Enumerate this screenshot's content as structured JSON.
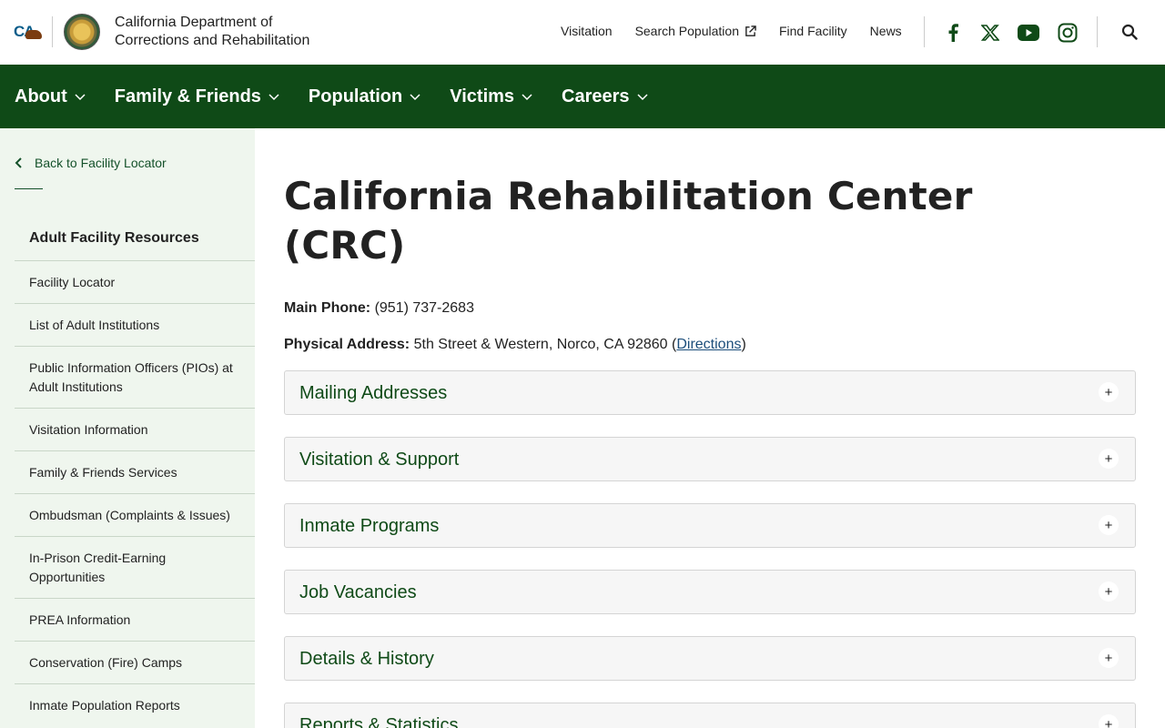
{
  "header": {
    "logo_text": "CA",
    "org_name_line1": "California Department of",
    "org_name_line2": "Corrections and Rehabilitation",
    "top_links": [
      {
        "label": "Visitation",
        "external": false
      },
      {
        "label": "Search Population",
        "external": true
      },
      {
        "label": "Find Facility",
        "external": false
      },
      {
        "label": "News",
        "external": false
      }
    ],
    "social_icons": [
      "facebook-icon",
      "x-twitter-icon",
      "youtube-icon",
      "instagram-icon"
    ],
    "search_icon": "search-icon"
  },
  "nav": {
    "items": [
      {
        "label": "About"
      },
      {
        "label": "Family & Friends"
      },
      {
        "label": "Population"
      },
      {
        "label": "Victims"
      },
      {
        "label": "Careers"
      }
    ]
  },
  "sidebar": {
    "back_label": "Back to Facility Locator",
    "heading": "Adult Facility Resources",
    "items": [
      {
        "label": "Facility Locator"
      },
      {
        "label": "List of Adult Institutions"
      },
      {
        "label": "Public Information Officers (PIOs) at Adult Institutions"
      },
      {
        "label": "Visitation Information"
      },
      {
        "label": "Family & Friends Services"
      },
      {
        "label": "Ombudsman (Complaints & Issues)"
      },
      {
        "label": "In-Prison Credit-Earning Opportunities"
      },
      {
        "label": "PREA Information"
      },
      {
        "label": "Conservation (Fire) Camps"
      },
      {
        "label": "Inmate Population Reports"
      }
    ]
  },
  "main": {
    "title": "California Rehabilitation Center (CRC)",
    "phone_label": "Main Phone:",
    "phone_value": "(951) 737-2683",
    "address_label": "Physical Address:",
    "address_value": "5th Street & Western, Norco, CA 92860 (",
    "directions_label": "Directions",
    "address_close": ")",
    "accordions": [
      {
        "title": "Mailing Addresses",
        "icon": "+"
      },
      {
        "title": "Visitation & Support",
        "icon": "+"
      },
      {
        "title": "Inmate Programs",
        "icon": "+"
      },
      {
        "title": "Job Vacancies",
        "icon": "+"
      },
      {
        "title": "Details & History",
        "icon": "+"
      },
      {
        "title": "Reports & Statistics",
        "icon": "+"
      }
    ]
  },
  "colors": {
    "nav_bg": "#0f4a17",
    "sidebar_bg": "#eff6ee",
    "accordion_title": "#0f4a17",
    "link": "#1b4d7a"
  }
}
